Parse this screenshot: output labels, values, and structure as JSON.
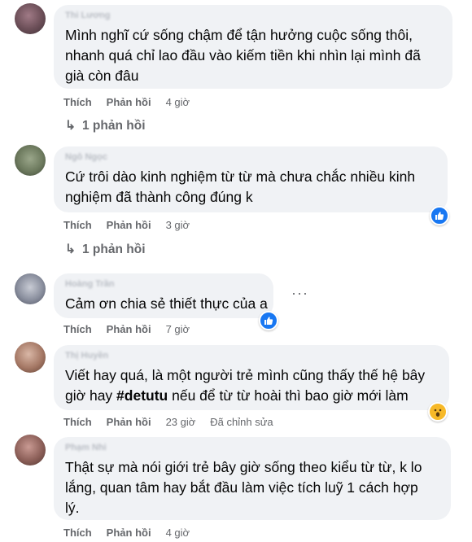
{
  "comments": [
    {
      "author": "Thi Lương",
      "text": "Mình nghĩ cứ sống chậm để tận hưởng cuộc sống thôi,\nnhanh quá chỉ lao đầu vào kiếm tiền khi nhìn lại mình đã\ngià còn đâu",
      "like": "Thích",
      "reply": "Phản hồi",
      "time": "4 giờ",
      "replies": "1 phản hồi"
    },
    {
      "author": "Ngô Ngọc",
      "text": "Cứ trôi dào kinh nghiệm từ từ mà chưa chắc nhiều kinh\nnghiệm đã thành công đúng k",
      "like": "Thích",
      "reply": "Phản hồi",
      "time": "3 giờ",
      "replies": "1 phản hồi",
      "reaction": "like-icon"
    },
    {
      "author": "Hoàng Trần",
      "text": "Cảm ơn chia sẻ thiết thực của a",
      "like": "Thích",
      "reply": "Phản hồi",
      "time": "7 giờ",
      "reaction": "like-icon",
      "more": "···"
    },
    {
      "author": "Thị Huyền",
      "text_before": "Viết hay quá, là một người trẻ mình cũng thấy thế hệ bây\ngiờ hay ",
      "hashtag": "#detutu",
      "text_after": " nếu để từ từ hoài thì bao giờ mới làm",
      "like": "Thích",
      "reply": "Phản hồi",
      "time": "23 giờ",
      "edited": "Đã chỉnh sửa",
      "reaction": "wow-icon"
    },
    {
      "author": "Phạm Nhi",
      "text": "Thật sự mà nói giới trẻ bây giờ sống theo kiểu từ từ, k lo\nlắng, quan tâm hay bắt đầu làm việc tích luỹ 1 cách hợp\nlý.",
      "like": "Thích",
      "reply": "Phản hồi",
      "time": "4 giờ"
    }
  ],
  "colors": {
    "bubble": "#f0f2f5",
    "meta": "#65676b",
    "like_blue": "#1877f2",
    "wow_yellow": "#f7b928"
  }
}
